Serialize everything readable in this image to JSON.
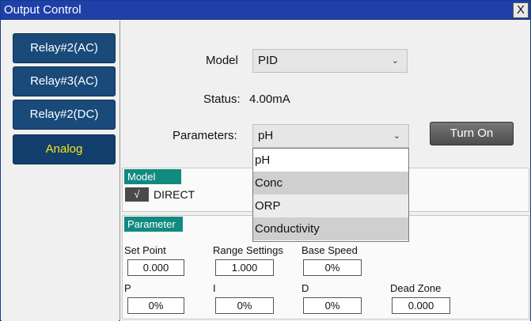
{
  "window": {
    "title": "Output Control",
    "close_label": "X"
  },
  "sidebar": {
    "items": [
      {
        "label": "Relay#2(AC)"
      },
      {
        "label": "Relay#3(AC)"
      },
      {
        "label": "Relay#2(DC)"
      },
      {
        "label": "Analog"
      }
    ]
  },
  "main": {
    "model_label": "Model",
    "model_value": "PID",
    "status_label": "Status:",
    "status_value": "4.00mA",
    "parameters_label": "Parameters:",
    "parameters_value": "pH",
    "turn_on_label": "Turn On",
    "parameter_options": [
      "pH",
      "Conc",
      "ORP",
      "Conductivity"
    ]
  },
  "model_group": {
    "tag": "Model",
    "check_glyph": "√",
    "direct_label": "DIRECT"
  },
  "parameter_group": {
    "tag": "Parameter",
    "set_point_label": "Set Point",
    "set_point_value": "0.000",
    "range_label": "Range Settings",
    "range_value": "1.000",
    "base_speed_label": "Base Speed",
    "base_speed_value": "0%",
    "p_label": "P",
    "p_value": "0%",
    "i_label": "I",
    "i_value": "0%",
    "d_label": "D",
    "d_value": "0%",
    "dead_zone_label": "Dead Zone",
    "dead_zone_value": "0.000"
  },
  "icons": {
    "chevron": "chevron-down-icon",
    "check": "checkmark-icon"
  },
  "colors": {
    "title_bar": "#1e40a8",
    "nav_button": "#1a4a7a",
    "active_nav_text": "#f5e61a",
    "group_tag": "#118a80"
  }
}
